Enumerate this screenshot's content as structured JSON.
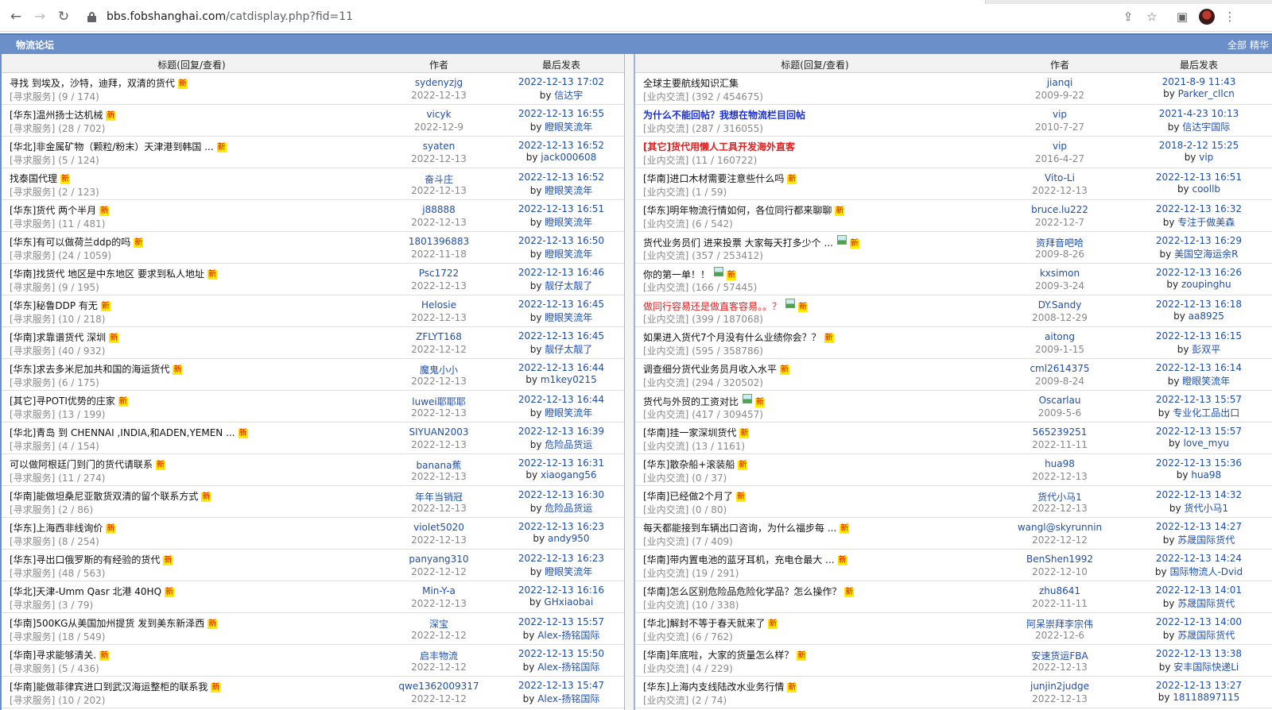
{
  "browser": {
    "url_host": "bbs.fobshanghai.com",
    "url_path": "/catdisplay.php?fid=11"
  },
  "forum": {
    "title": "物流论坛",
    "link_all": "全部",
    "link_digest": "精华"
  },
  "headers": {
    "title": "标题(回复/查看)",
    "author": "作者",
    "last_post": "最后发表"
  },
  "left_threads": [
    {
      "title": "寻找 到埃及，沙特，迪拜，双清的货代",
      "cat": "[寻求服务]",
      "stats": "(9 / 174)",
      "author": "sydenyzjg",
      "date": "2022-12-13",
      "last_time": "2022-12-13 17:02",
      "last_user": "信达宇"
    },
    {
      "title": "[华东]温州扬士达机械",
      "cat": "[寻求服务]",
      "stats": "(28 / 702)",
      "author": "vicyk",
      "date": "2022-12-9",
      "last_time": "2022-12-13 16:55",
      "last_user": "瞪眼笑流年"
    },
    {
      "title": "[华北]非金属矿物（颗粒/粉末）天津港到韩国 ...",
      "cat": "[寻求服务]",
      "stats": "(5 / 124)",
      "author": "syaten",
      "date": "2022-12-13",
      "last_time": "2022-12-13 16:52",
      "last_user": "jack000608"
    },
    {
      "title": "找泰国代理",
      "cat": "[寻求服务]",
      "stats": "(2 / 123)",
      "author": "奋斗庄",
      "date": "2022-12-13",
      "last_time": "2022-12-13 16:52",
      "last_user": "瞪眼笑流年"
    },
    {
      "title": "[华东]货代 两个半月",
      "cat": "[寻求服务]",
      "stats": "(11 / 481)",
      "author": "j88888",
      "date": "2022-12-13",
      "last_time": "2022-12-13 16:51",
      "last_user": "瞪眼笑流年"
    },
    {
      "title": "[华东]有可以做荷兰ddp的吗",
      "cat": "[寻求服务]",
      "stats": "(24 / 1059)",
      "author": "1801396883",
      "date": "2022-11-18",
      "last_time": "2022-12-13 16:50",
      "last_user": "瞪眼笑流年"
    },
    {
      "title": "[华南]找货代 地区是中东地区 要求到私人地址",
      "cat": "[寻求服务]",
      "stats": "(9 / 195)",
      "author": "Psc1722",
      "date": "2022-12-13",
      "last_time": "2022-12-13 16:46",
      "last_user": "靓仔太靓了"
    },
    {
      "title": "[华东]秘鲁DDP 有无",
      "cat": "[寻求服务]",
      "stats": "(10 / 218)",
      "author": "Helosie",
      "date": "2022-12-13",
      "last_time": "2022-12-13 16:45",
      "last_user": "瞪眼笑流年"
    },
    {
      "title": "[华南]求靠谱货代 深圳",
      "cat": "[寻求服务]",
      "stats": "(40 / 932)",
      "author": "ZFLYT168",
      "date": "2022-12-12",
      "last_time": "2022-12-13 16:45",
      "last_user": "靓仔太靓了"
    },
    {
      "title": "[华东]求去多米尼加共和国的海运货代",
      "cat": "[寻求服务]",
      "stats": "(6 / 175)",
      "author": "魔鬼小小",
      "date": "2022-12-13",
      "last_time": "2022-12-13 16:44",
      "last_user": "m1key0215"
    },
    {
      "title": "[其它]寻POTI优势的庄家",
      "cat": "[寻求服务]",
      "stats": "(13 / 199)",
      "author": "luwei耶耶耶",
      "date": "2022-12-13",
      "last_time": "2022-12-13 16:44",
      "last_user": "瞪眼笑流年"
    },
    {
      "title": "[华北]青岛 到 CHENNAI ,INDIA,和ADEN,YEMEN ...",
      "cat": "[寻求服务]",
      "stats": "(4 / 154)",
      "author": "SIYUAN2003",
      "date": "2022-12-13",
      "last_time": "2022-12-13 16:39",
      "last_user": "危险品货运"
    },
    {
      "title": "可以做阿根廷门到门的货代请联系",
      "cat": "[寻求服务]",
      "stats": "(11 / 274)",
      "author": "banana蕉",
      "date": "2022-12-13",
      "last_time": "2022-12-13 16:31",
      "last_user": "xiaogang56"
    },
    {
      "title": "[华南]能做坦桑尼亚散货双清的留个联系方式",
      "cat": "[寻求服务]",
      "stats": "(2 / 86)",
      "author": "年年当销冠",
      "date": "2022-12-13",
      "last_time": "2022-12-13 16:30",
      "last_user": "危险品货运"
    },
    {
      "title": "[华东]上海西非线询价",
      "cat": "[寻求服务]",
      "stats": "(8 / 254)",
      "author": "violet5020",
      "date": "2022-12-13",
      "last_time": "2022-12-13 16:23",
      "last_user": "andy950"
    },
    {
      "title": "[华东]寻出口俄罗斯的有经验的货代",
      "cat": "[寻求服务]",
      "stats": "(48 / 563)",
      "author": "panyang310",
      "date": "2022-12-12",
      "last_time": "2022-12-13 16:23",
      "last_user": "瞪眼笑流年"
    },
    {
      "title": "[华北]天津-Umm Qasr 北港 40HQ",
      "cat": "[寻求服务]",
      "stats": "(3 / 79)",
      "author": "Min-Y-a",
      "date": "2022-12-13",
      "last_time": "2022-12-13 16:16",
      "last_user": "GHxiaobai"
    },
    {
      "title": "[华南]500KG从美国加州提货 发到美东新泽西",
      "cat": "[寻求服务]",
      "stats": "(18 / 549)",
      "author": "深宝",
      "date": "2022-12-12",
      "last_time": "2022-12-13 15:57",
      "last_user": "Alex-扬铭国际"
    },
    {
      "title": "[华南]寻求能够清关.",
      "cat": "[寻求服务]",
      "stats": "(5 / 436)",
      "author": "启丰物流",
      "date": "2022-12-12",
      "last_time": "2022-12-13 15:50",
      "last_user": "Alex-扬铭国际"
    },
    {
      "title": "[华南]能做菲律宾进口到武汉海运整柜的联系我",
      "cat": "[寻求服务]",
      "stats": "(10 / 202)",
      "author": "qwe1362009317",
      "date": "2022-12-12",
      "last_time": "2022-12-13 15:47",
      "last_user": "Alex-扬铭国际"
    }
  ],
  "right_threads": [
    {
      "title": "全球主要航线知识汇集",
      "style": "normal",
      "img": false,
      "new": false,
      "cat": "[业内交流]",
      "stats": "(392 / 454675)",
      "author": "jianqi",
      "date": "2009-9-22",
      "last_time": "2021-8-9 11:43",
      "last_user": "Parker_cllcn"
    },
    {
      "title": "为什么不能回帖？我想在物流栏目回帖",
      "style": "blue",
      "img": false,
      "new": false,
      "cat": "[业内交流]",
      "stats": "(287 / 316055)",
      "author": "vip",
      "date": "2010-7-27",
      "last_time": "2021-4-23 10:13",
      "last_user": "信达宇国际"
    },
    {
      "title": "[其它]货代用懒人工具开发海外直客",
      "style": "red",
      "img": false,
      "new": false,
      "cat": "[业内交流]",
      "stats": "(11 / 160722)",
      "author": "vip",
      "date": "2016-4-27",
      "last_time": "2018-2-12 15:25",
      "last_user": "vip"
    },
    {
      "title": "[华南]进口木材需要注意些什么吗",
      "style": "normal",
      "img": false,
      "new": true,
      "cat": "[业内交流]",
      "stats": "(1 / 59)",
      "author": "Vito-Li",
      "date": "2022-12-13",
      "last_time": "2022-12-13 16:51",
      "last_user": "coollb"
    },
    {
      "title": "[华东]明年物流行情如何，各位同行都来聊聊",
      "style": "normal",
      "img": false,
      "new": true,
      "cat": "[业内交流]",
      "stats": "(6 / 542)",
      "author": "bruce.lu222",
      "date": "2022-12-7",
      "last_time": "2022-12-13 16:32",
      "last_user": "专注于做美森"
    },
    {
      "title": "货代业务员们 进来投票 大家每天打多少个 ...",
      "style": "normal",
      "img": true,
      "new": true,
      "cat": "[业内交流]",
      "stats": "(357 / 253412)",
      "author": "资拜音吧哈",
      "date": "2009-8-26",
      "last_time": "2022-12-13 16:29",
      "last_user": "美国空海运余R"
    },
    {
      "title": "你的第一单！！",
      "style": "normal",
      "img": true,
      "new": true,
      "cat": "[业内交流]",
      "stats": "(166 / 57445)",
      "author": "kxsimon",
      "date": "2009-3-24",
      "last_time": "2022-12-13 16:26",
      "last_user": "zoupinghu"
    },
    {
      "title": "做同行容易还是做直客容易。。？",
      "style": "redplain",
      "img": true,
      "new": true,
      "cat": "[业内交流]",
      "stats": "(399 / 187068)",
      "author": "DY.Sandy",
      "date": "2008-12-29",
      "last_time": "2022-12-13 16:18",
      "last_user": "aa8925"
    },
    {
      "title": "如果进入货代7个月没有什么业绩你会？？",
      "style": "normal",
      "img": false,
      "new": true,
      "cat": "[业内交流]",
      "stats": "(595 / 358786)",
      "author": "aitong",
      "date": "2009-1-15",
      "last_time": "2022-12-13 16:15",
      "last_user": "彭双平"
    },
    {
      "title": "调查细分货代业务员月收入水平",
      "style": "normal",
      "img": false,
      "new": true,
      "cat": "[业内交流]",
      "stats": "(294 / 320502)",
      "author": "cml2614375",
      "date": "2009-8-24",
      "last_time": "2022-12-13 16:14",
      "last_user": "瞪眼笑流年"
    },
    {
      "title": "货代与外贸的工资对比",
      "style": "normal",
      "img": true,
      "new": true,
      "cat": "[业内交流]",
      "stats": "(417 / 309457)",
      "author": "Oscarlau",
      "date": "2009-5-6",
      "last_time": "2022-12-13 15:57",
      "last_user": "专业化工品出口"
    },
    {
      "title": "[华南]挂一家深圳货代",
      "style": "normal",
      "img": false,
      "new": true,
      "cat": "[业内交流]",
      "stats": "(13 / 1161)",
      "author": "565239251",
      "date": "2022-11-11",
      "last_time": "2022-12-13 15:57",
      "last_user": "love_myu"
    },
    {
      "title": "[华东]散杂船+滚装船",
      "style": "normal",
      "img": false,
      "new": true,
      "cat": "[业内交流]",
      "stats": "(0 / 37)",
      "author": "hua98",
      "date": "2022-12-13",
      "last_time": "2022-12-13 15:36",
      "last_user": "hua98"
    },
    {
      "title": "[华南]已经做2个月了",
      "style": "normal",
      "img": false,
      "new": true,
      "cat": "[业内交流]",
      "stats": "(0 / 80)",
      "author": "货代小马1",
      "date": "2022-12-13",
      "last_time": "2022-12-13 14:32",
      "last_user": "货代小马1"
    },
    {
      "title": "每天都能接到车辆出口咨询，为什么福步每 ...",
      "style": "normal",
      "img": false,
      "new": true,
      "cat": "[业内交流]",
      "stats": "(7 / 409)",
      "author": "wangl@skyrunnin",
      "date": "2022-12-12",
      "last_time": "2022-12-13 14:27",
      "last_user": "苏晟国际货代"
    },
    {
      "title": "[华南]带内置电池的蓝牙耳机，充电仓最大 ...",
      "style": "normal",
      "img": false,
      "new": true,
      "cat": "[业内交流]",
      "stats": "(19 / 291)",
      "author": "BenShen1992",
      "date": "2022-12-10",
      "last_time": "2022-12-13 14:24",
      "last_user": "国际物流人-Dvid"
    },
    {
      "title": "[华南]怎么区别危险品危险化学品？怎么操作？",
      "style": "normal",
      "img": false,
      "new": true,
      "cat": "[业内交流]",
      "stats": "(10 / 338)",
      "author": "zhu8641",
      "date": "2022-11-11",
      "last_time": "2022-12-13 14:01",
      "last_user": "苏晟国际货代"
    },
    {
      "title": "[华北]解封不等于春天就来了",
      "style": "normal",
      "img": false,
      "new": true,
      "cat": "[业内交流]",
      "stats": "(6 / 762)",
      "author": "阿呆崇拜李宗伟",
      "date": "2022-12-6",
      "last_time": "2022-12-13 14:00",
      "last_user": "苏晟国际货代"
    },
    {
      "title": "[华南]年底啦，大家的货量怎么样？",
      "style": "normal",
      "img": false,
      "new": true,
      "cat": "[业内交流]",
      "stats": "(4 / 229)",
      "author": "安速货运FBA",
      "date": "2022-12-13",
      "last_time": "2022-12-13 13:38",
      "last_user": "安丰国际快递Li"
    },
    {
      "title": "[华东]上海内支线陆改水业务行情",
      "style": "normal",
      "img": false,
      "new": true,
      "cat": "[业内交流]",
      "stats": "(2 / 74)",
      "author": "junjin2judge",
      "date": "2022-12-13",
      "last_time": "2022-12-13 13:27",
      "last_user": "18118897115"
    }
  ],
  "labels": {
    "new_tag": "新",
    "by": "by"
  }
}
